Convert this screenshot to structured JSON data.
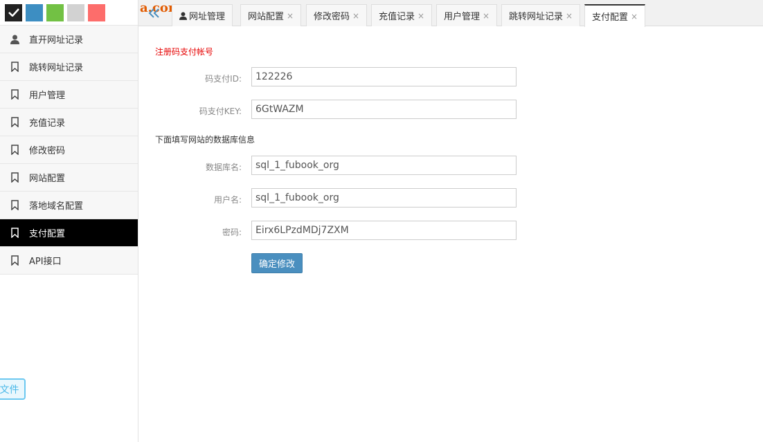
{
  "theme_colors": [
    "#222222",
    "#3d8ec2",
    "#72c144",
    "#d2d2d2",
    "#fd6d6b"
  ],
  "sidebar": {
    "items": [
      {
        "label": "直开网址记录",
        "icon": "user-icon",
        "active": false
      },
      {
        "label": "跳转网址记录",
        "icon": "bookmark-icon",
        "active": false
      },
      {
        "label": "用户管理",
        "icon": "bookmark-icon",
        "active": false
      },
      {
        "label": "充值记录",
        "icon": "bookmark-icon",
        "active": false
      },
      {
        "label": "修改密码",
        "icon": "bookmark-icon",
        "active": false
      },
      {
        "label": "网站配置",
        "icon": "bookmark-icon",
        "active": false
      },
      {
        "label": "落地域名配置",
        "icon": "bookmark-icon",
        "active": false
      },
      {
        "label": "支付配置",
        "icon": "bookmark-icon",
        "active": true
      },
      {
        "label": "API接口",
        "icon": "bookmark-icon",
        "active": false
      }
    ],
    "float_button": "文件"
  },
  "watermark": "a.com",
  "tabs": [
    {
      "label": "网址管理",
      "closable": false,
      "icon": "user-icon"
    },
    {
      "label": "网站配置",
      "closable": true
    },
    {
      "label": "修改密码",
      "closable": true
    },
    {
      "label": "充值记录",
      "closable": true
    },
    {
      "label": "用户管理",
      "closable": true
    },
    {
      "label": "跳转网址记录",
      "closable": true
    },
    {
      "label": "支付配置",
      "closable": true,
      "active": true
    }
  ],
  "close_glyph": "×",
  "form": {
    "section1_title": "注册码支付帐号",
    "pay_id": {
      "label": "码支付ID:",
      "value": "122226"
    },
    "pay_key": {
      "label": "码支付KEY:",
      "value": "6GtWAZM"
    },
    "section2_title": "下面填写网站的数据库信息",
    "db_name": {
      "label": "数据库名:",
      "value": "sql_1_fubook_org"
    },
    "db_user": {
      "label": "用户名:",
      "value": "sql_1_fubook_org"
    },
    "db_pass": {
      "label": "密码:",
      "value": "Eirx6LPzdMDj7ZXM"
    },
    "submit_label": "确定修改"
  }
}
